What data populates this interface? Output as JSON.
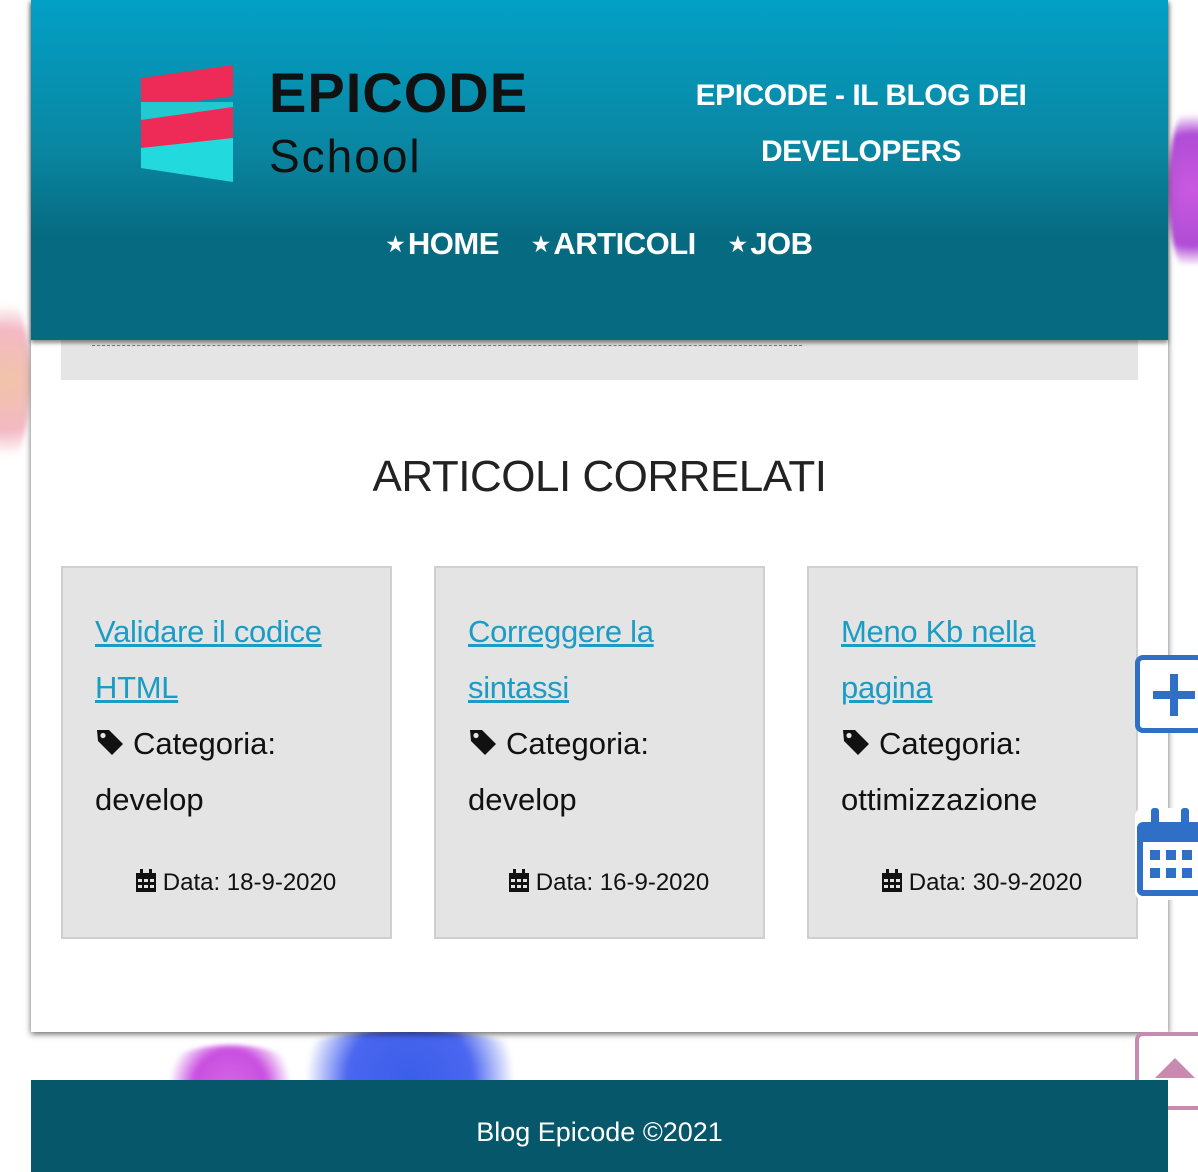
{
  "header": {
    "logo": {
      "line1": "EPICODE",
      "line2": "School"
    },
    "site_title": "EPICODE - IL BLOG DEI DEVELOPERS",
    "nav": [
      {
        "label": "HOME"
      },
      {
        "label": "ARTICOLI"
      },
      {
        "label": "JOB"
      }
    ]
  },
  "section": {
    "title": "ARTICOLI CORRELATI"
  },
  "articles": [
    {
      "title": "Validare il codice HTML",
      "category_label": "Categoria:",
      "category": "develop",
      "date_label": "Data: 18-9-2020"
    },
    {
      "title": "Correggere la sintassi",
      "category_label": "Categoria:",
      "category": "develop",
      "date_label": "Data: 16-9-2020"
    },
    {
      "title": "Meno Kb nella pagina",
      "category_label": "Categoria:",
      "category": "ottimizzazione",
      "date_label": "Data: 30-9-2020"
    }
  ],
  "footer": {
    "text": "Blog Epicode ©2021"
  },
  "colors": {
    "header_top": "#03a0c6",
    "header_bottom": "#066a80",
    "link": "#1b9cc4",
    "footer": "#065769",
    "side_button_blue": "#2f6fc6",
    "side_button_pink": "#c98ab0"
  },
  "icons": [
    "star-icon",
    "tag-icon",
    "calendar-icon",
    "plus-icon",
    "arrow-up-icon"
  ]
}
